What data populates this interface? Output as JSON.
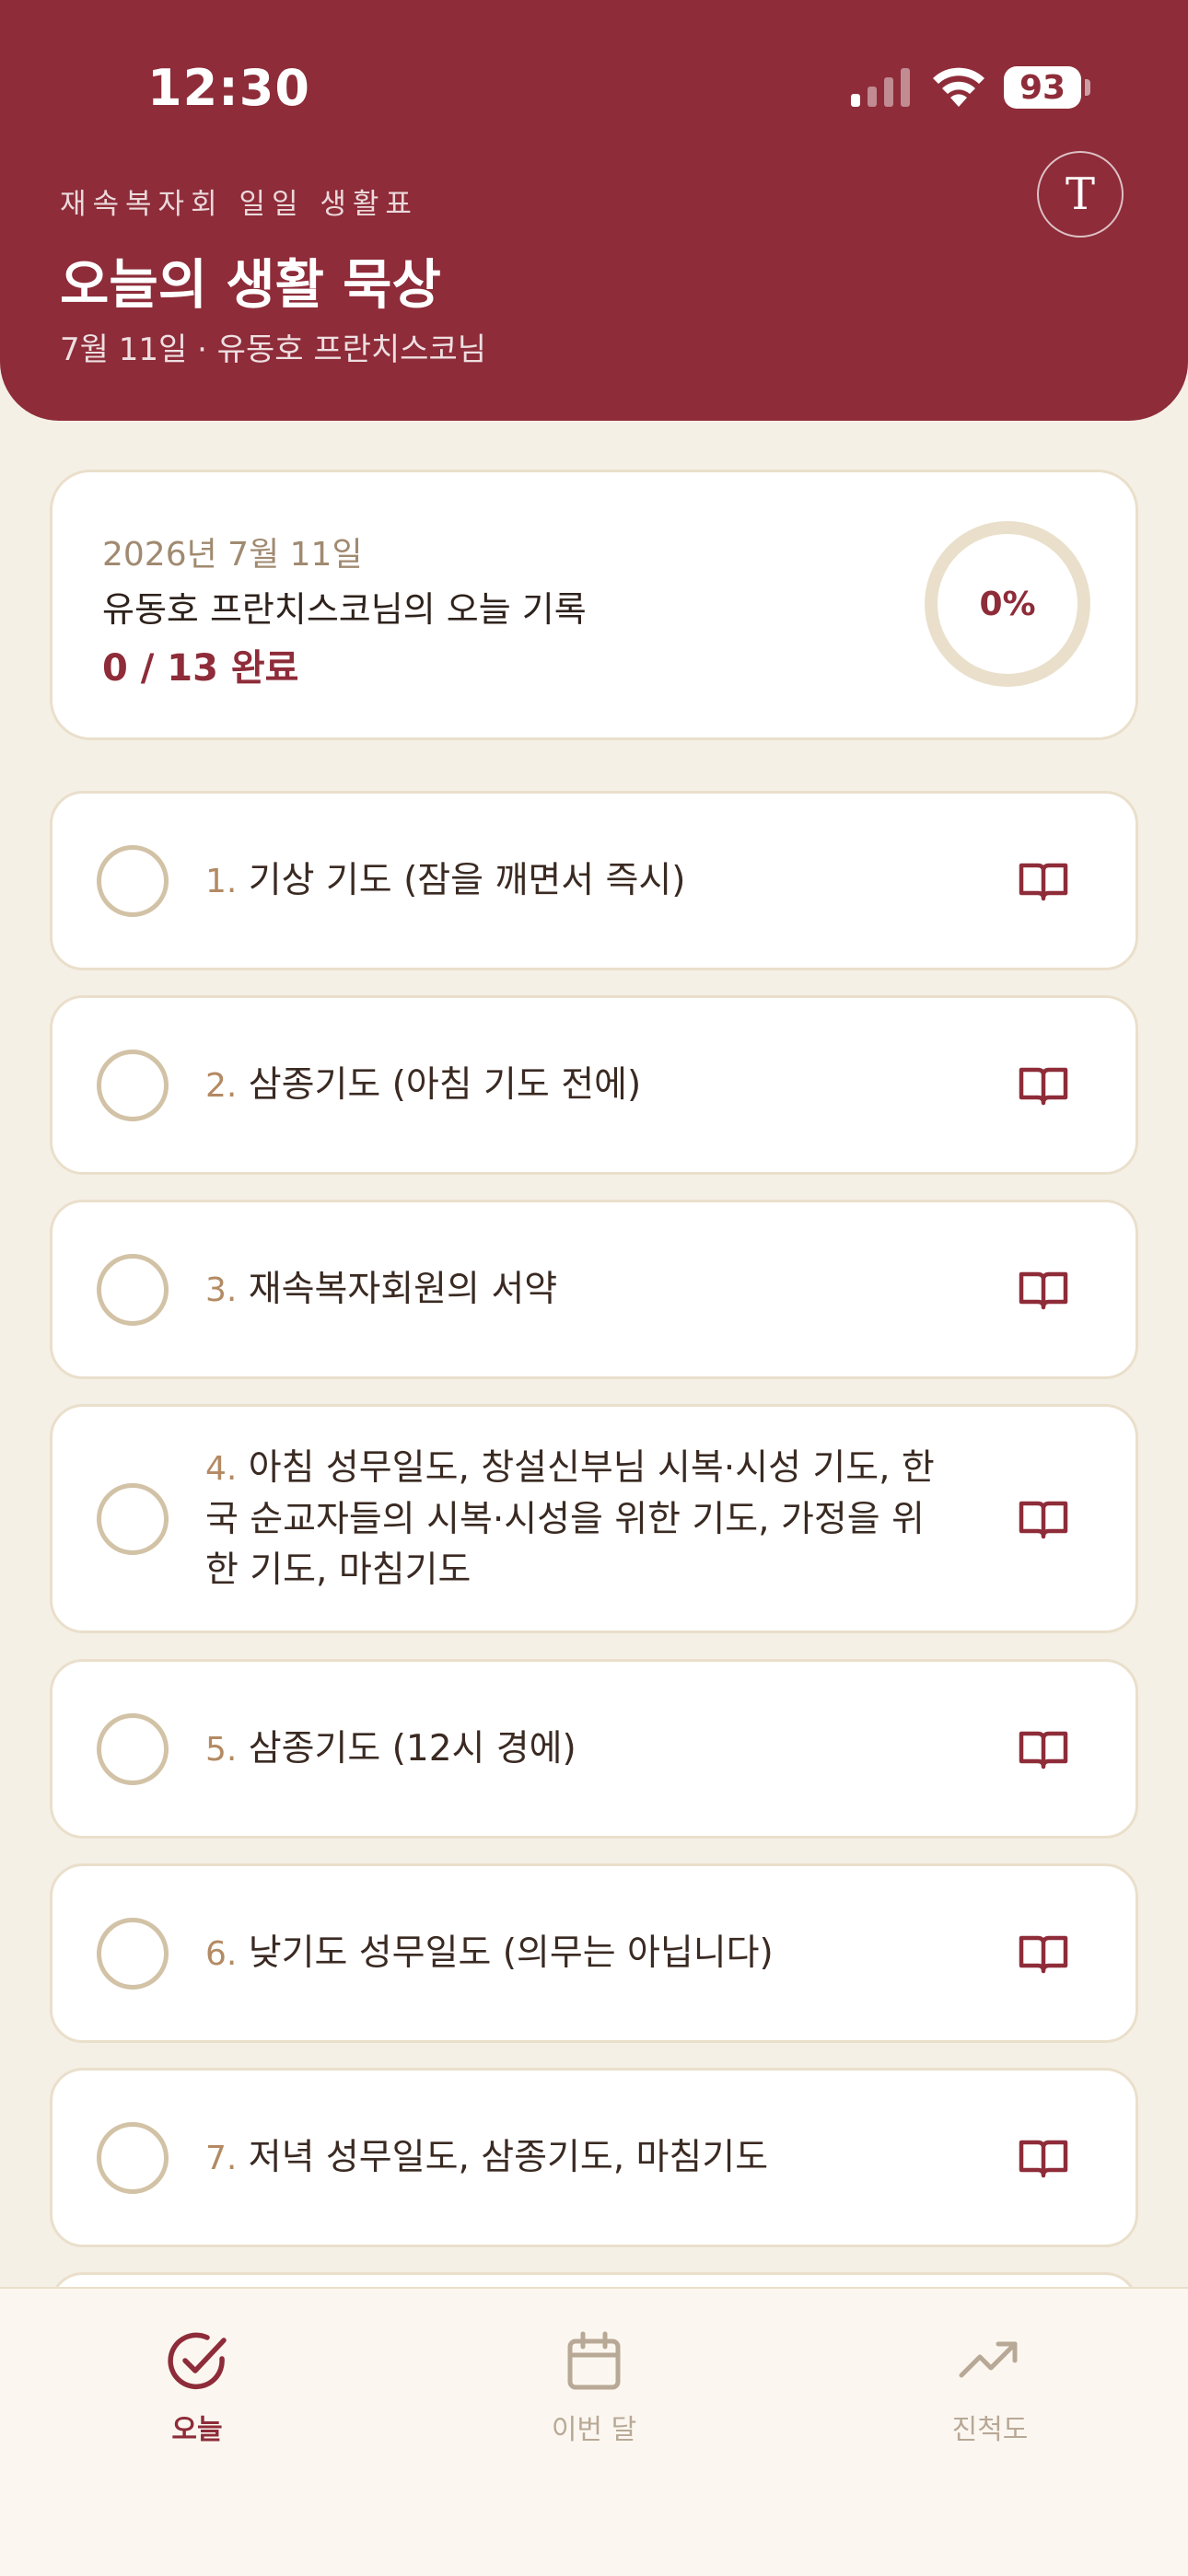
{
  "status_bar": {
    "time": "12:30",
    "battery": "93"
  },
  "header": {
    "subtitle": "재속복자회 일일 생활표",
    "title": "오늘의 생활 묵상",
    "date_line": "7월 11일 · 유동호 프란치스코님",
    "text_size_glyph": "T"
  },
  "summary": {
    "date": "2026년 7월 11일",
    "name_line": "유동호 프란치스코님의 오늘 기록",
    "count": "0 / 13 완료",
    "percent_label": "0%",
    "progress_fraction": 0
  },
  "tasks": [
    {
      "num": "1.",
      "text": "기상 기도 (잠을 깨면서 즉시)"
    },
    {
      "num": "2.",
      "text": "삼종기도 (아침 기도 전에)"
    },
    {
      "num": "3.",
      "text": "재속복자회원의 서약"
    },
    {
      "num": "4.",
      "text": "아침 성무일도, 창설신부님 시복·시성 기도, 한국 순교자들의 시복·시성을 위한 기도, 가정을 위한 기도, 마침기도"
    },
    {
      "num": "5.",
      "text": "삼종기도 (12시 경에)"
    },
    {
      "num": "6.",
      "text": "낮기도 성무일도 (의무는 아닙니다)"
    },
    {
      "num": "7.",
      "text": "저녁 성무일도, 삼종기도, 마침기도"
    }
  ],
  "nav": [
    {
      "label": "오늘",
      "icon": "check-circle-icon",
      "active": true
    },
    {
      "label": "이번 달",
      "icon": "calendar-icon",
      "active": false
    },
    {
      "label": "진척도",
      "icon": "trending-up-icon",
      "active": false
    }
  ],
  "colors": {
    "accent": "#8E2C39",
    "background": "#F5F0E6",
    "card_border": "#EADFCB",
    "muted": "#B8A896"
  }
}
